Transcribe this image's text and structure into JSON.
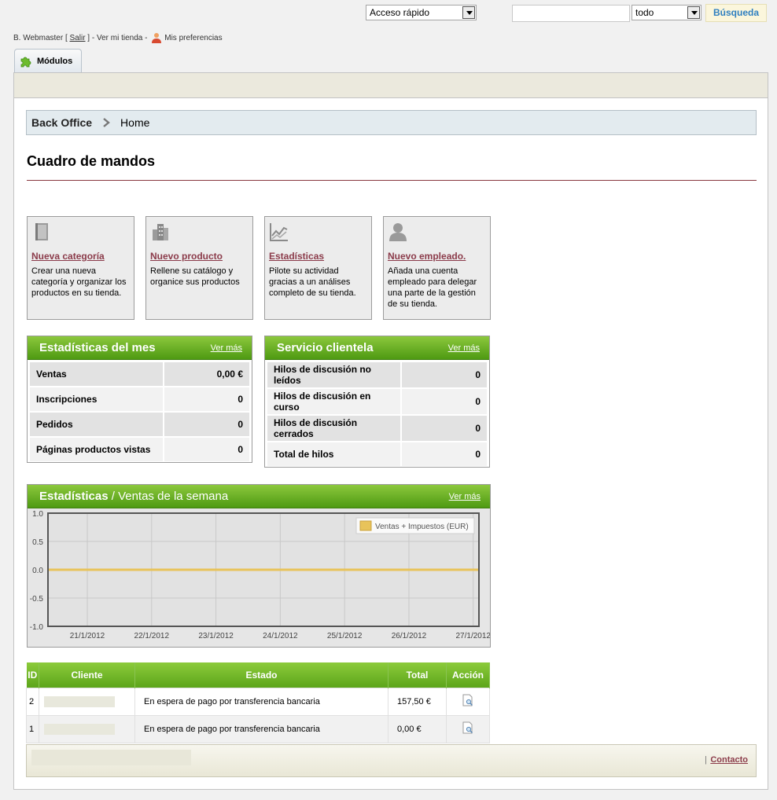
{
  "topbar": {
    "quick_access": "Acceso rápido",
    "search_scope": "todo",
    "search_value": "",
    "search_button": "Búsqueda"
  },
  "user": {
    "name": "B. Webmaster",
    "open_bracket": " [ ",
    "logout": "Salir",
    "close_bracket": " ] - ",
    "view_store": "Ver mi tienda",
    "dash": " - ",
    "preferences": "Mis preferencias"
  },
  "tabs": [
    {
      "label": "Módulos"
    }
  ],
  "breadcrumb": {
    "root": "Back Office",
    "current": "Home"
  },
  "page_title": "Cuadro de mandos",
  "quick_actions": [
    {
      "title": "Nueva categoría",
      "desc": "Crear una nueva categoría y organizar los productos en su tienda.",
      "icon": "book-icon"
    },
    {
      "title": "Nuevo producto",
      "desc": "Rellene su catálogo y organice sus productos",
      "icon": "building-icon"
    },
    {
      "title": "Estadísticas",
      "desc": "Pilote su actividad gracias a un análises completo de su tienda.",
      "icon": "chart-icon"
    },
    {
      "title": "Nuevo empleado.",
      "desc": "Añada una cuenta empleado para delegar una parte de la gestión de su tienda.",
      "icon": "person-icon"
    }
  ],
  "month_stats": {
    "title": "Estadísticas del mes",
    "more": "Ver más",
    "rows": [
      {
        "label": "Ventas",
        "value": "0,00 €"
      },
      {
        "label": "Inscripciones",
        "value": "0"
      },
      {
        "label": "Pedidos",
        "value": "0"
      },
      {
        "label": "Páginas productos vistas",
        "value": "0"
      }
    ]
  },
  "customer_service": {
    "title": "Servicio clientela",
    "more": "Ver más",
    "rows": [
      {
        "label": "Hilos de discusión no leídos",
        "value": "0"
      },
      {
        "label": "Hilos de discusión en curso",
        "value": "0"
      },
      {
        "label": "Hilos de discusión cerrados",
        "value": "0"
      },
      {
        "label": "Total de hilos",
        "value": "0"
      }
    ]
  },
  "weekly_chart": {
    "title": "Estadísticas",
    "slash": " / ",
    "subtitle": "Ventas de la semana",
    "more": "Ver más"
  },
  "chart_data": {
    "type": "line",
    "x": [
      "21/1/2012",
      "22/1/2012",
      "23/1/2012",
      "24/1/2012",
      "25/1/2012",
      "26/1/2012",
      "27/1/2012"
    ],
    "series": [
      {
        "name": "Ventas + Impuestos (EUR)",
        "values": [
          0,
          0,
          0,
          0,
          0,
          0,
          0
        ],
        "color": "#e8c35a"
      }
    ],
    "yticks": [
      "1.0",
      "0.5",
      "0.0",
      "-0.5",
      "-1.0"
    ],
    "ylim": [
      -1,
      1
    ],
    "grid": true,
    "legend": "top-right"
  },
  "orders": {
    "headers": [
      "ID",
      "Cliente",
      "Estado",
      "Total",
      "Acción"
    ],
    "rows": [
      {
        "id": "2",
        "client": "",
        "status": "En espera de pago por transferencia bancaria",
        "total": "157,50 €"
      },
      {
        "id": "1",
        "client": "",
        "status": "En espera de pago por transferencia bancaria",
        "total": "0,00 €"
      }
    ]
  },
  "footer": {
    "separator": "|",
    "contact": "Contacto"
  },
  "colors": {
    "accent_green": "#5ca51a",
    "link_red": "#8b3b4a",
    "series": "#e8c35a"
  }
}
